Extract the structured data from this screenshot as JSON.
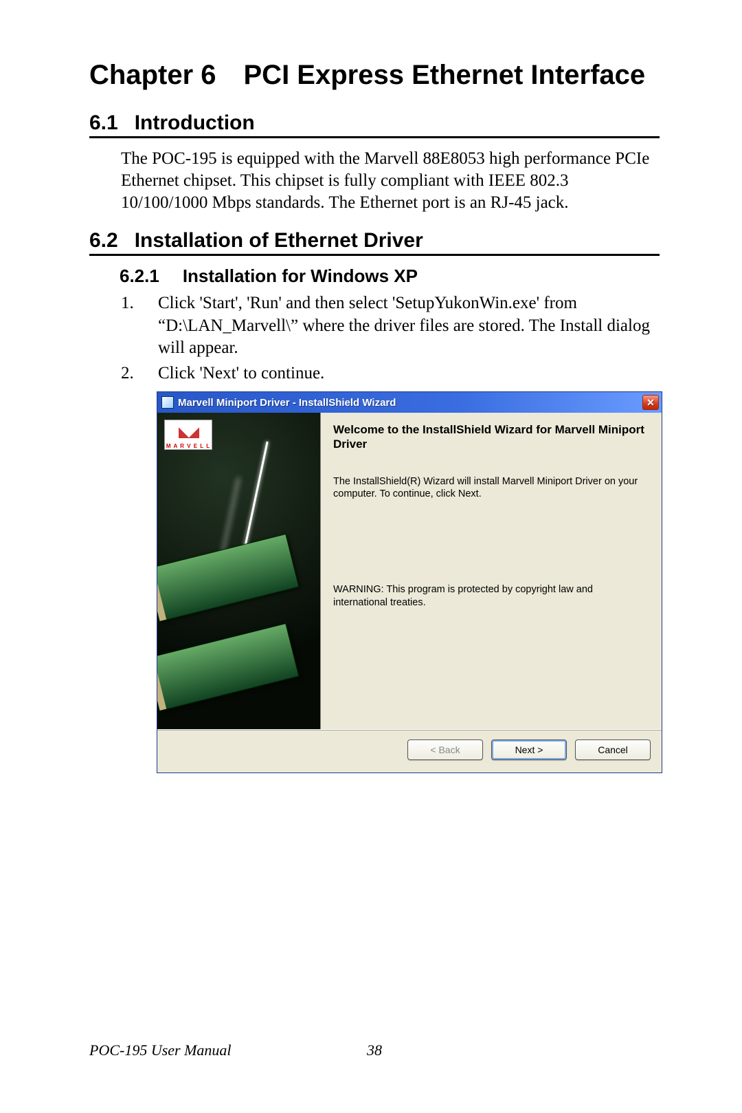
{
  "chapter": {
    "label": "Chapter 6",
    "title": "PCI Express Ethernet Interface"
  },
  "section1": {
    "num": "6.1",
    "title": "Introduction",
    "body": "The POC-195 is equipped with the Marvell 88E8053 high performance PCIe Ethernet chipset. This chipset is fully compliant with IEEE 802.3 10/100/1000 Mbps standards. The Ethernet port is an RJ-45 jack."
  },
  "section2": {
    "num": "6.2",
    "title": "Installation of Ethernet Driver"
  },
  "subsection": {
    "num": "6.2.1",
    "title": "Installation for Windows XP"
  },
  "steps": [
    {
      "n": "1.",
      "text": "Click 'Start', 'Run' and then select 'SetupYukonWin.exe' from “D:\\LAN_Marvell\\” where the driver files are stored. The Install dialog will appear."
    },
    {
      "n": "2.",
      "text": "Click 'Next' to continue."
    }
  ],
  "wizard": {
    "title": "Marvell Miniport Driver - InstallShield Wizard",
    "logo_text": "M A R V E L L",
    "welcome": "Welcome to the InstallShield Wizard for Marvell Miniport Driver",
    "desc": "The InstallShield(R) Wizard will install Marvell Miniport Driver on your computer. To continue, click Next.",
    "warning": "WARNING: This program is protected by copyright law and international treaties.",
    "buttons": {
      "back": "< Back",
      "next": "Next >",
      "cancel": "Cancel"
    }
  },
  "footer": {
    "doc": "POC-195 User Manual",
    "page": "38"
  }
}
